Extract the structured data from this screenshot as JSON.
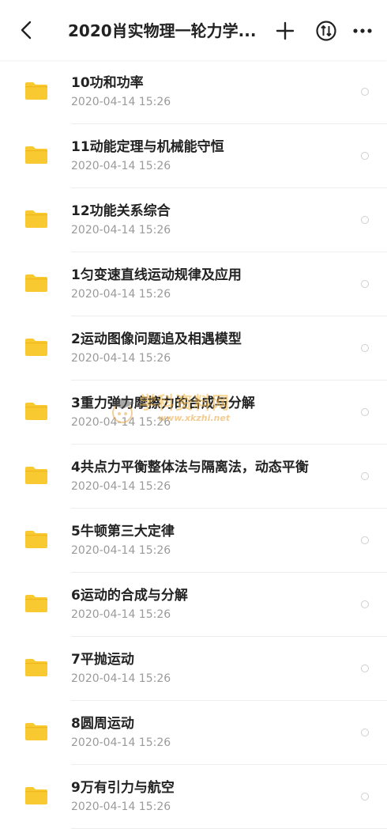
{
  "header": {
    "title": "2020肖实物理一轮力学...",
    "back_icon": "chevron-left-icon",
    "add_icon": "plus-icon",
    "sort_icon": "sort-arrows-icon",
    "more_icon": "more-horizontal-icon"
  },
  "files": [
    {
      "name": "10功和功率",
      "date": "2020-04-14  15:26"
    },
    {
      "name": "11动能定理与机械能守恒",
      "date": "2020-04-14  15:26"
    },
    {
      "name": "12功能关系综合",
      "date": "2020-04-14  15:26"
    },
    {
      "name": "1匀变速直线运动规律及应用",
      "date": "2020-04-14  15:26"
    },
    {
      "name": "2运动图像问题追及相遇模型",
      "date": "2020-04-14  15:26"
    },
    {
      "name": "3重力弹力摩擦力的合成与分解",
      "date": "2020-04-14  15:26"
    },
    {
      "name": "4共点力平衡整体法与隔离法，动态平衡",
      "date": "2020-04-14  15:26"
    },
    {
      "name": "5牛顿第三大定律",
      "date": "2020-04-14  15:26"
    },
    {
      "name": "6运动的合成与分解",
      "date": "2020-04-14  15:26"
    },
    {
      "name": "7平抛运动",
      "date": "2020-04-14  15:26"
    },
    {
      "name": "8圆周运动",
      "date": "2020-04-14  15:26"
    },
    {
      "name": "9万有引力与航空",
      "date": "2020-04-14  15:26"
    }
  ],
  "watermark": {
    "text": "学科资料网",
    "url": "www.xkzhi.net"
  },
  "colors": {
    "folder": "#f8c930",
    "folder_tab": "#f0b81c",
    "text_primary": "#222222",
    "text_secondary": "#9a9a9a"
  }
}
